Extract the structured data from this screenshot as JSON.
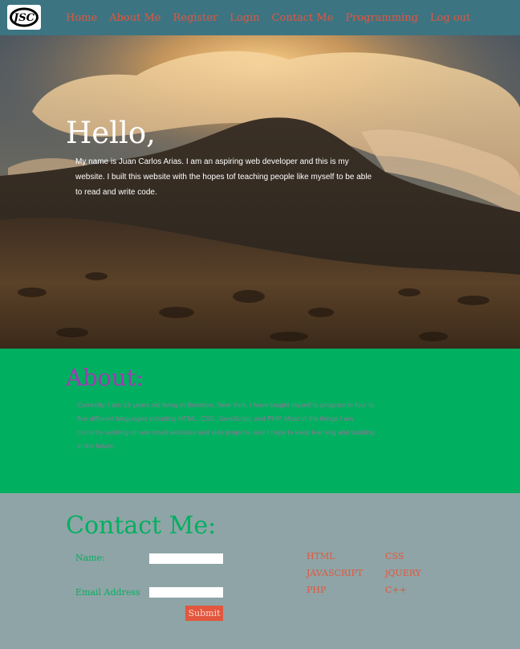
{
  "nav": {
    "logo_text": "JSC",
    "links": [
      "Home",
      "About Me",
      "Register",
      "Login",
      "Contact Me",
      "Programming",
      "Log out"
    ]
  },
  "hero": {
    "title": "Hello,",
    "text": "My name is Juan Carlos Arias.  I am an aspiring web developer and this is my website. I built this website with the hopes tof teaching people like myself to be able to read and write code."
  },
  "about": {
    "title": "About:",
    "text": "Currently, I am 19 years old living in Brooklyn, New York. I have taught myself to program in four to five different languages including HTML, CSS, JavaScript, and PHP. Most of the things I am currently working on are small websites and side projects, and I hope to keep learning and building in the future."
  },
  "contact": {
    "title": "Contact Me:",
    "name_label": "Name:",
    "name_value": "",
    "email_label": "Email Address",
    "email_value": "",
    "submit_label": "Submit"
  },
  "skills": [
    "HTML",
    "CSS",
    "JAVASCRIPT",
    "jQUERY",
    "PHP",
    "C++"
  ],
  "colors": {
    "nav_bg": "#3c7482",
    "link": "#e2573e",
    "about_bg": "#00b060",
    "about_title": "#9b3fb0",
    "contact_bg": "#8fa4a6",
    "contact_title": "#00b060"
  }
}
